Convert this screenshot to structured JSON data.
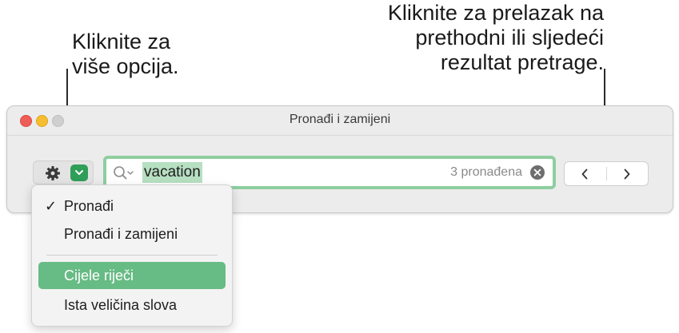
{
  "callouts": {
    "options": {
      "lines": [
        "Kliknite za",
        "više opcija."
      ]
    },
    "navigate": {
      "lines": [
        "Kliknite za prelazak na",
        "prethodni ili sljedeći",
        "rezultat pretrage."
      ]
    }
  },
  "window": {
    "title": "Pronađi i zamijeni"
  },
  "toolbar": {
    "gear_icon": "gear-icon",
    "options_chevron_icon": "chevron-down-icon"
  },
  "search": {
    "value": "vacation",
    "result_count": "3 pronađena",
    "search_icon": "magnifier-with-dropdown-icon",
    "clear_icon": "clear-circle-x-icon"
  },
  "navigation": {
    "previous_icon": "chevron-left-icon",
    "next_icon": "chevron-right-icon"
  },
  "menu": {
    "items": [
      {
        "label": "Pronađi",
        "checked": true
      },
      {
        "label": "Pronađi i zamijeni",
        "checked": false
      },
      {
        "label": "Cijele riječi",
        "highlighted": true
      },
      {
        "label": "Ista veličina slova",
        "highlighted": false
      }
    ],
    "check_mark": "✓"
  },
  "colors": {
    "accent_green": "#2f9e58",
    "field_focus_ring": "#8fce9f",
    "text_selection": "#b7dfc1",
    "menu_highlight": "#67bb84",
    "close": "#ee5d57",
    "minimize": "#f5bd2f"
  }
}
